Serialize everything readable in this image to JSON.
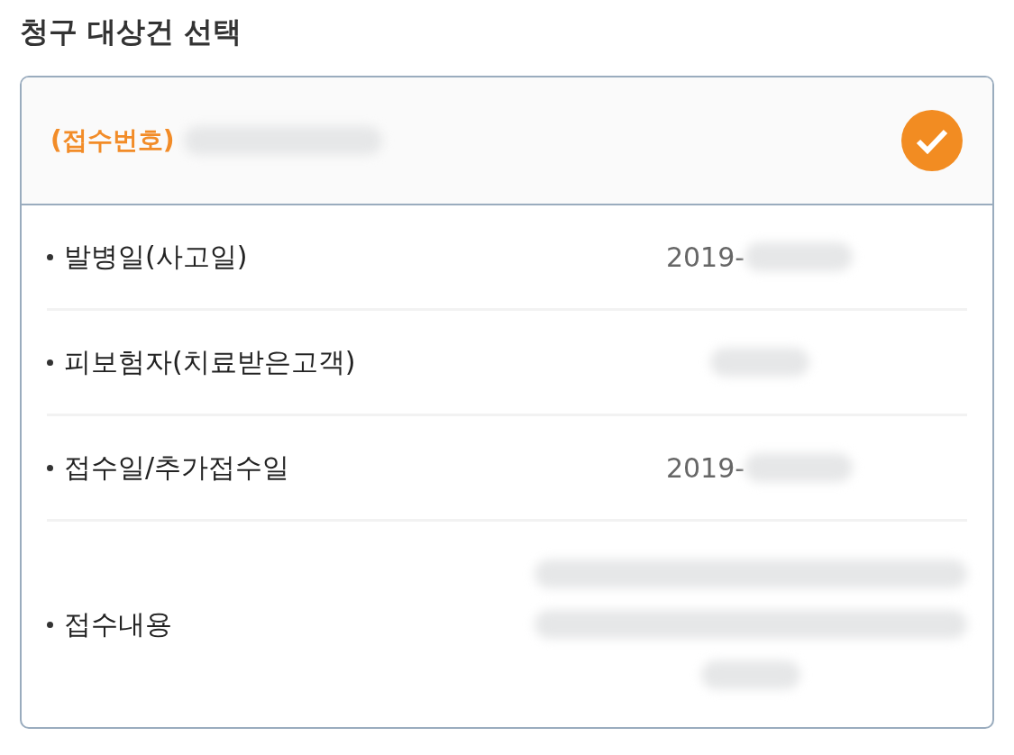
{
  "title": "청구 대상건 선택",
  "claim": {
    "label": "(접수번호)",
    "checked": true
  },
  "rows": [
    {
      "label": "발병일(사고일)",
      "kind": "line",
      "value": "2019-"
    },
    {
      "label": "피보험자(치료받은고객)",
      "kind": "line"
    },
    {
      "label": "접수일/추가접수일",
      "kind": "line",
      "value": "2019-"
    },
    {
      "label": "접수내용",
      "kind": "paragraph"
    }
  ]
}
